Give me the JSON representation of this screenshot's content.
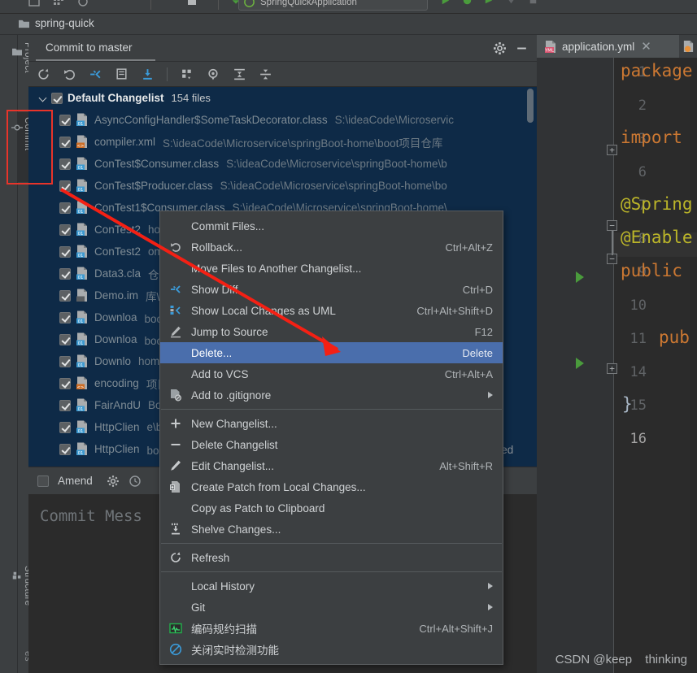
{
  "window": {
    "project_name": "spring-quick",
    "run_configuration": "SpringQuickApplication"
  },
  "left_tool_strip": {
    "tabs": [
      {
        "label": "Project",
        "icon": "folder-icon"
      },
      {
        "label": "Commit",
        "icon": "commit-icon"
      },
      {
        "label": "Structure",
        "icon": "structure-icon"
      },
      {
        "label": "es",
        "icon": "favorites-icon"
      }
    ],
    "highlight_color": "#e8342a"
  },
  "commit_panel": {
    "title": "Commit to master",
    "gear_icon": "gear-icon",
    "minimize_icon": "minimize-icon",
    "toolbar": [
      {
        "name": "refresh-changes-icon",
        "tooltip": "Refresh Changes"
      },
      {
        "name": "rollback-icon",
        "tooltip": "Rollback"
      },
      {
        "name": "show-diff-icon",
        "tooltip": "Show Diff"
      },
      {
        "name": "edit-changelist-icon",
        "tooltip": "Edit Changelist"
      },
      {
        "name": "shelve-changes-icon",
        "tooltip": "Shelve Silently"
      },
      {
        "name": "group-by-icon",
        "tooltip": "Group By"
      },
      {
        "name": "preview-diff-icon",
        "tooltip": "Preview Diff"
      },
      {
        "name": "expand-all-icon",
        "tooltip": "Expand All"
      },
      {
        "name": "collapse-all-icon",
        "tooltip": "Collapse All"
      }
    ],
    "changelist": {
      "name": "Default Changelist",
      "count_label": "154 files",
      "expanded": true,
      "checked": true
    },
    "files": [
      {
        "name": "AsyncConfigHandler$SomeTaskDecorator.class",
        "path": "S:\\ideaCode\\Microservic",
        "icon": "class-file-icon"
      },
      {
        "name": "compiler.xml",
        "path": "S:\\ideaCode\\Microservice\\springBoot-home\\boot项目仓库",
        "icon": "xml-file-icon"
      },
      {
        "name": "ConTest$Consumer.class",
        "path": "S:\\ideaCode\\Microservice\\springBoot-home\\b",
        "icon": "class-file-icon"
      },
      {
        "name": "ConTest$Producer.class",
        "path": "S:\\ideaCode\\Microservice\\springBoot-home\\bo",
        "icon": "class-file-icon"
      },
      {
        "name": "ConTest1$Consumer.class",
        "path": "S:\\ideaCode\\Microservice\\springBoot-home\\",
        "icon": "class-file-icon"
      },
      {
        "name": "ConTest2",
        "path": "home\\",
        "icon": "class-file-icon"
      },
      {
        "name": "ConTest2",
        "path": "ome\\b",
        "icon": "class-file-icon"
      },
      {
        "name": "Data3.cla",
        "path": "仓库\\b",
        "icon": "class-file-icon"
      },
      {
        "name": "Demo.im",
        "path": "库\\be",
        "icon": "iml-file-icon"
      },
      {
        "name": "Downloa",
        "path": "boot项",
        "icon": "class-file-icon"
      },
      {
        "name": "Downloa",
        "path": "boot项",
        "icon": "class-file-icon"
      },
      {
        "name": "Downlo",
        "path": "home\\",
        "icon": "class-file-icon"
      },
      {
        "name": "encoding",
        "path": "项目仓庫",
        "icon": "xml-file-icon"
      },
      {
        "name": "FairAndU",
        "path": "Boot-h",
        "icon": "class-file-icon"
      },
      {
        "name": "HttpClien",
        "path": "e\\boot",
        "icon": "class-file-icon"
      },
      {
        "name": "HttpClien",
        "path": "boot项",
        "icon": "class-file-icon"
      }
    ],
    "amend": {
      "label": "Amend",
      "checked": false
    },
    "amend_gear_icon": "gear-icon",
    "amend_history_icon": "history-icon",
    "commit_message_placeholder": "Commit Mess",
    "deleted_hint": "eted"
  },
  "context_menu": {
    "selected_item": "Delete...",
    "items": [
      {
        "label": "Commit Files...",
        "shortcut": "",
        "icon": "",
        "submenu": false,
        "separator_after": false
      },
      {
        "label": "Rollback...",
        "shortcut": "Ctrl+Alt+Z",
        "icon": "rollback-icon",
        "submenu": false,
        "separator_after": false
      },
      {
        "label": "Move Files to Another Changelist...",
        "shortcut": "",
        "icon": "",
        "submenu": false,
        "separator_after": false
      },
      {
        "label": "Show Diff",
        "shortcut": "Ctrl+D",
        "icon": "show-diff-icon",
        "submenu": false,
        "separator_after": false
      },
      {
        "label": "Show Local Changes as UML",
        "shortcut": "Ctrl+Alt+Shift+D",
        "icon": "uml-icon",
        "submenu": false,
        "separator_after": false
      },
      {
        "label": "Jump to Source",
        "shortcut": "F12",
        "icon": "jump-to-source-icon",
        "submenu": false,
        "separator_after": false
      },
      {
        "label": "Delete...",
        "shortcut": "Delete",
        "icon": "",
        "submenu": false,
        "separator_after": false
      },
      {
        "label": "Add to VCS",
        "shortcut": "Ctrl+Alt+A",
        "icon": "",
        "submenu": false,
        "separator_after": false
      },
      {
        "label": "Add to .gitignore",
        "shortcut": "",
        "icon": "gitignore-icon",
        "submenu": true,
        "separator_after": true
      },
      {
        "label": "New Changelist...",
        "shortcut": "",
        "icon": "plus-icon",
        "submenu": false,
        "separator_after": false
      },
      {
        "label": "Delete Changelist",
        "shortcut": "",
        "icon": "minus-icon",
        "submenu": false,
        "separator_after": false
      },
      {
        "label": "Edit Changelist...",
        "shortcut": "Alt+Shift+R",
        "icon": "pencil-icon",
        "submenu": false,
        "separator_after": false
      },
      {
        "label": "Create Patch from Local Changes...",
        "shortcut": "",
        "icon": "patch-icon",
        "submenu": false,
        "separator_after": false
      },
      {
        "label": "Copy as Patch to Clipboard",
        "shortcut": "",
        "icon": "",
        "submenu": false,
        "separator_after": false
      },
      {
        "label": "Shelve Changes...",
        "shortcut": "",
        "icon": "shelve-icon",
        "submenu": false,
        "separator_after": true
      },
      {
        "label": "Refresh",
        "shortcut": "",
        "icon": "refresh-icon",
        "submenu": false,
        "separator_after": true
      },
      {
        "label": "Local History",
        "shortcut": "",
        "icon": "",
        "submenu": true,
        "separator_after": false
      },
      {
        "label": "Git",
        "shortcut": "",
        "icon": "",
        "submenu": true,
        "separator_after": false
      },
      {
        "label": "编码规约扫描",
        "shortcut": "Ctrl+Alt+Shift+J",
        "icon": "alibaba-scan-icon",
        "submenu": false,
        "separator_after": false
      },
      {
        "label": "关闭实时检测功能",
        "shortcut": "",
        "icon": "disable-realtime-icon",
        "submenu": false,
        "separator_after": false
      }
    ],
    "selection_color": "#4a6eac"
  },
  "editor": {
    "tab_name": "application.yml",
    "tab_icon": "yml-file-icon",
    "tab_close_icon": "close-icon",
    "second_tab_icon": "java-file-icon",
    "line_numbers": [
      "1",
      "2",
      "3",
      "6",
      "7",
      "8",
      "9",
      "10",
      "11",
      "14",
      "15",
      "16"
    ],
    "current_line": "16",
    "code_lines": [
      {
        "line": "1",
        "text": "package",
        "kind": "keyword"
      },
      {
        "line": "2",
        "text": "",
        "kind": "plain"
      },
      {
        "line": "3",
        "text": "import",
        "kind": "keyword"
      },
      {
        "line": "6",
        "text": "",
        "kind": "plain"
      },
      {
        "line": "7",
        "text": "@Spring",
        "kind": "annotation"
      },
      {
        "line": "8",
        "text": "@Enable",
        "kind": "annotation"
      },
      {
        "line": "9",
        "text": "public",
        "kind": "keyword"
      },
      {
        "line": "10",
        "text": "",
        "kind": "plain"
      },
      {
        "line": "11",
        "text": "pub",
        "kind": "keyword"
      },
      {
        "line": "14",
        "text": "",
        "kind": "plain"
      },
      {
        "line": "15",
        "text": "}",
        "kind": "brace"
      },
      {
        "line": "16",
        "text": "",
        "kind": "plain"
      }
    ]
  },
  "watermark": {
    "part1": "CSDN @keep",
    "part2": "thinking"
  }
}
